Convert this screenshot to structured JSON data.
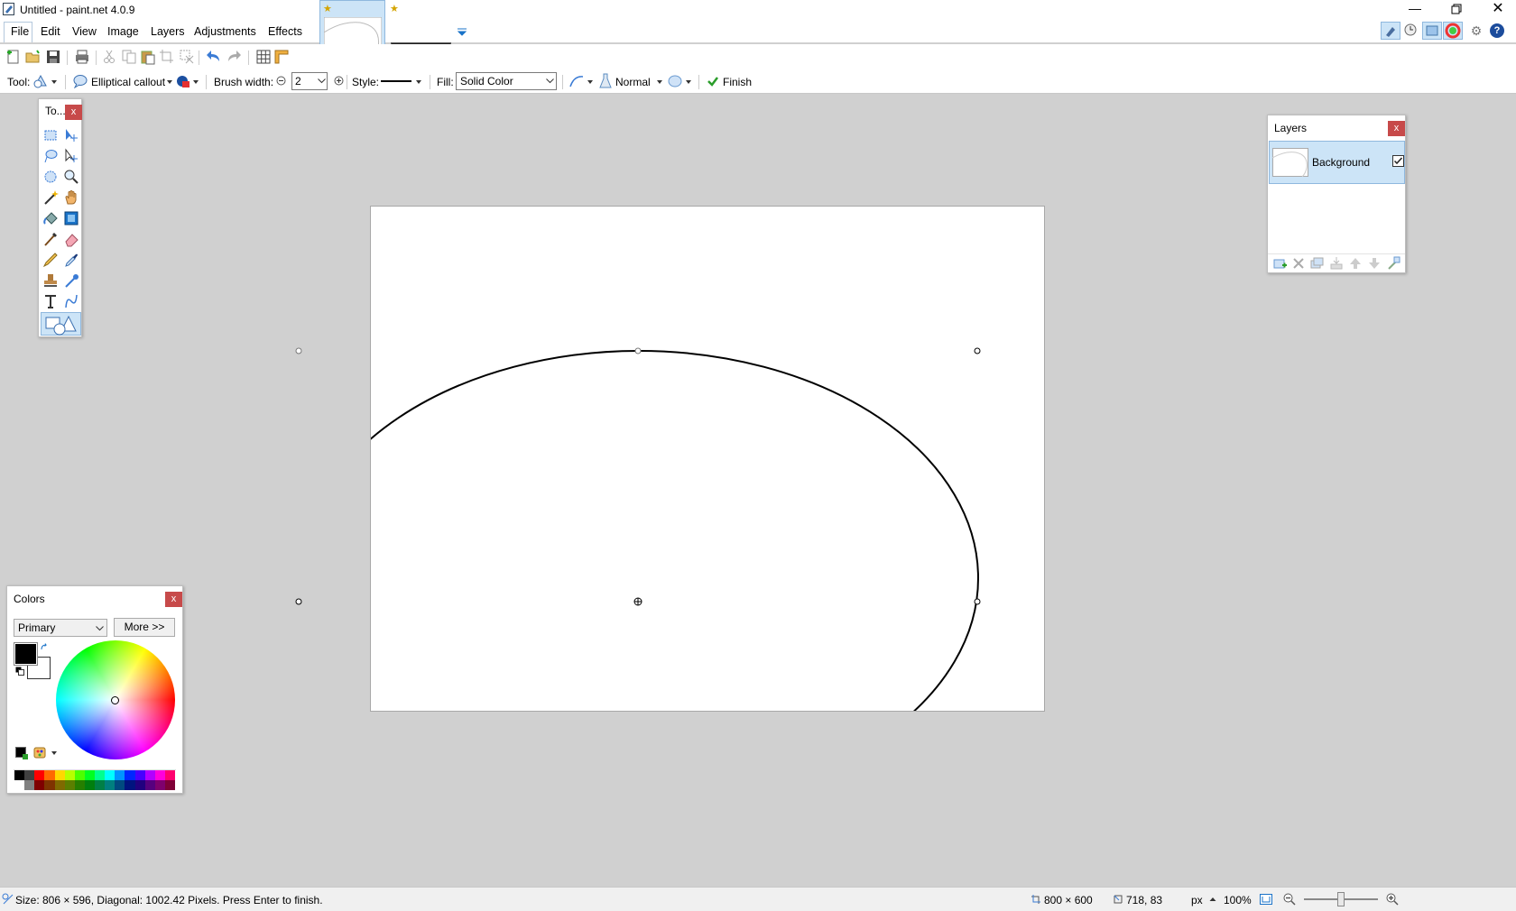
{
  "window": {
    "title": "Untitled - paint.net 4.0.9"
  },
  "menu": [
    "File",
    "Edit",
    "View",
    "Image",
    "Layers",
    "Adjustments",
    "Effects"
  ],
  "toolbar2": {
    "tool_label": "Tool:",
    "shape_label": "Elliptical callout",
    "brush_width_label": "Brush width:",
    "brush_width_value": "2",
    "style_label": "Style:",
    "fill_label": "Fill:",
    "fill_value": "Solid Color",
    "blend_mode": "Normal",
    "finish_label": "Finish"
  },
  "tools_panel": {
    "title": "To...",
    "close": "x"
  },
  "layers_panel": {
    "title": "Layers",
    "close": "x",
    "layers": [
      {
        "name": "Background",
        "visible": true
      }
    ]
  },
  "colors_panel": {
    "title": "Colors",
    "close": "x",
    "mode_value": "Primary",
    "more_button": "More >>",
    "primary_color": "#000000",
    "secondary_color": "#ffffff",
    "palette_top": [
      "#000000",
      "#404040",
      "#ff0000",
      "#ff6a00",
      "#ffd800",
      "#b6ff00",
      "#4cff00",
      "#00ff21",
      "#00ff90",
      "#00ffff",
      "#0094ff",
      "#0026ff",
      "#4800ff",
      "#b200ff",
      "#ff00dc",
      "#ff006e"
    ],
    "palette_bottom": [
      "#ffffff",
      "#808080",
      "#7f0000",
      "#7f3300",
      "#7f6a00",
      "#5b7f00",
      "#267f00",
      "#007f0e",
      "#007f46",
      "#007f7f",
      "#004a7f",
      "#00137f",
      "#21007f",
      "#57007f",
      "#7f006e",
      "#7f0037"
    ]
  },
  "status": {
    "message": "Size: 806 × 596, Diagonal: 1002.42 Pixels. Press Enter to finish.",
    "image_size": "800 × 600",
    "cursor_pos": "718, 83",
    "units": "px",
    "zoom": "100%"
  },
  "colors": {
    "accent": "#cce4f7",
    "close_red": "#c74a4a",
    "workspace": "#d0d0d0"
  }
}
